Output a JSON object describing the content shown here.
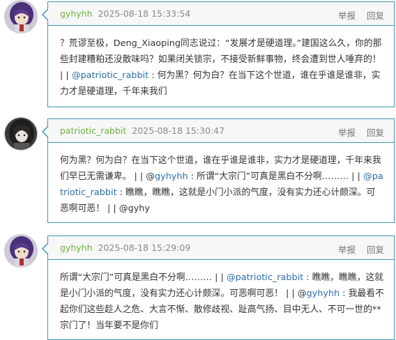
{
  "actions": {
    "report": "举报",
    "reply": "回复"
  },
  "comments": [
    {
      "user": "gyhyhh",
      "time": "2025-08-18 15:33:54",
      "avatar_style": "purple-hair",
      "segments": [
        {
          "t": "？荒谬至极，Deng_Xiaoping同志说过：“发展才是硬道理。”建国这么久，你的那些封建糟粕还没散味吗？如果闭关锁宗，不接受新鲜事物，终会遭到世人唾弃的！ | | "
        },
        {
          "t": "@patriotic_rabbit",
          "m": true
        },
        {
          "t": " : 何为黑？何为白？在当下这个世道，谁在乎谁是谁非，实力才是硬道理，千年来我们"
        }
      ]
    },
    {
      "user": "patriotic_rabbit",
      "time": "2025-08-18 15:30:47",
      "avatar_style": "dark-hair",
      "segments": [
        {
          "t": "何为黑？何为白？在当下这个世道，谁在乎谁是谁非，实力才是硬道理，千年来我们早已无需谦卑。 | | @"
        },
        {
          "t": "gyhyhh",
          "m": true
        },
        {
          "t": " : 所谓“大宗门”可真是黑白不分啊……… | | "
        },
        {
          "t": "@patriotic_rabbit",
          "m": true
        },
        {
          "t": " : 瞧瞧，瞧瞧，这就是小门小派的气度，没有实力还心计颇深。可恶啊可恶！ | | @gyhy"
        }
      ]
    },
    {
      "user": "gyhyhh",
      "time": "2025-08-18 15:29:09",
      "avatar_style": "purple-hair",
      "segments": [
        {
          "t": "所谓“大宗门”可真是黑白不分啊……… | | "
        },
        {
          "t": "@patriotic_rabbit",
          "m": true
        },
        {
          "t": " : 瞧瞧，瞧瞧，这就是小门小派的气度，没有实力还心计颇深。可恶啊可恶！ | | @"
        },
        {
          "t": "gyhyhh",
          "m": true
        },
        {
          "t": " : 我最看不起你们这些趁人之危、大言不惭、散修歧视、趾高气扬、目中无人、不可一世的**宗门了！当年要不是你们"
        }
      ]
    }
  ]
}
